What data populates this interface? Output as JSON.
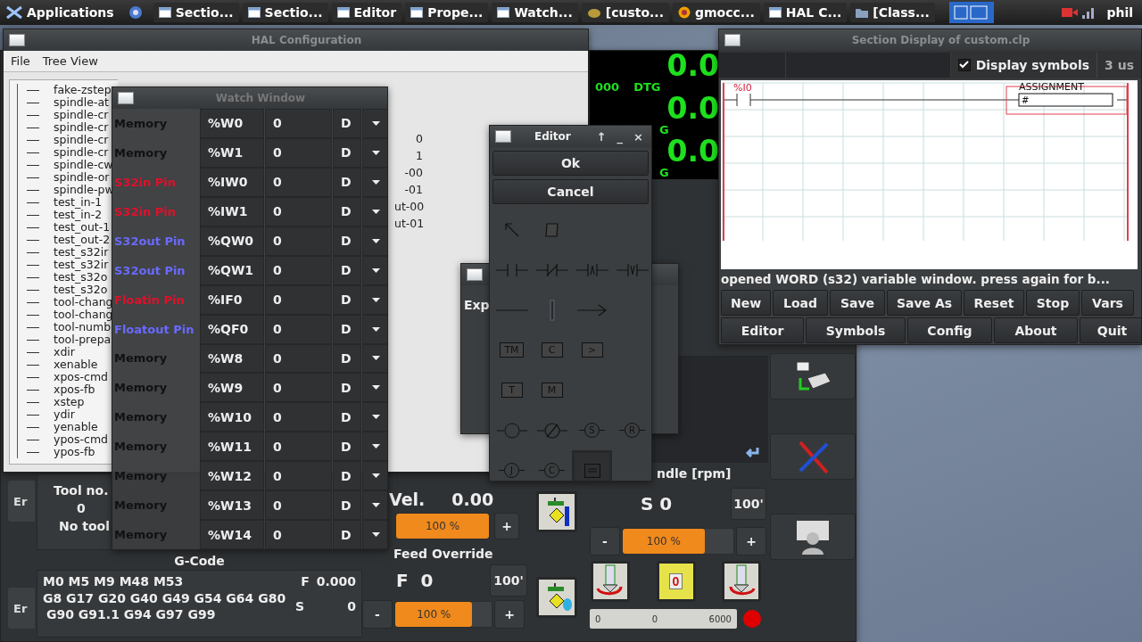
{
  "taskbar": {
    "menu": "Applications",
    "tasks": [
      {
        "label": "Sectio...",
        "kind": "window"
      },
      {
        "label": "Sectio...",
        "kind": "window"
      },
      {
        "label": "Editor",
        "kind": "window"
      },
      {
        "label": "Prope...",
        "kind": "window"
      },
      {
        "label": "Watch...",
        "kind": "window"
      },
      {
        "label": "[custo...",
        "kind": "app"
      },
      {
        "label": "gmocc...",
        "kind": "gmoccapy"
      },
      {
        "label": "HAL C...",
        "kind": "window"
      },
      {
        "label": "[Class...",
        "kind": "folder"
      }
    ],
    "user": "phil"
  },
  "hal_window": {
    "title": "HAL Configuration",
    "menu": [
      "File",
      "Tree View"
    ],
    "tree_items": [
      "fake-zstep",
      "spindle-at",
      "spindle-cr",
      "spindle-cr",
      "spindle-cr",
      "spindle-cr",
      "spindle-cw",
      "spindle-or",
      "spindle-pw",
      "test_in-1",
      "test_in-2",
      "test_out-1",
      "test_out-2",
      "test_s32ir",
      "test_s32ir",
      "test_s32o",
      "test_s32o",
      "tool-chang",
      "tool-chang",
      "tool-numb",
      "tool-prepa",
      "xdir",
      "xenable",
      "xpos-cmd",
      "xpos-fb",
      "xstep",
      "ydir",
      "yenable",
      "ypos-cmd",
      "ypos-fb"
    ],
    "fragments": [
      "0",
      "1",
      "-00",
      "-01",
      "ut-00",
      "ut-01"
    ]
  },
  "watch_window": {
    "title": "Watch Window",
    "rows": [
      {
        "kind": "memory",
        "label": "Memory",
        "variable": "%W0",
        "value": "0",
        "format": "D"
      },
      {
        "kind": "memory",
        "label": "Memory",
        "variable": "%W1",
        "value": "0",
        "format": "D"
      },
      {
        "kind": "s32in",
        "label": "S32in Pin",
        "variable": "%IW0",
        "value": "0",
        "format": "D"
      },
      {
        "kind": "s32in",
        "label": "S32in Pin",
        "variable": "%IW1",
        "value": "0",
        "format": "D"
      },
      {
        "kind": "s32out",
        "label": "S32out Pin",
        "variable": "%QW0",
        "value": "0",
        "format": "D"
      },
      {
        "kind": "s32out",
        "label": "S32out Pin",
        "variable": "%QW1",
        "value": "0",
        "format": "D"
      },
      {
        "kind": "floatin",
        "label": "Floatin Pin",
        "variable": "%IF0",
        "value": "0",
        "format": "D"
      },
      {
        "kind": "floatout",
        "label": "Floatout Pin",
        "variable": "%QF0",
        "value": "0",
        "format": "D"
      },
      {
        "kind": "memory",
        "label": "Memory",
        "variable": "%W8",
        "value": "0",
        "format": "D"
      },
      {
        "kind": "memory",
        "label": "Memory",
        "variable": "%W9",
        "value": "0",
        "format": "D"
      },
      {
        "kind": "memory",
        "label": "Memory",
        "variable": "%W10",
        "value": "0",
        "format": "D"
      },
      {
        "kind": "memory",
        "label": "Memory",
        "variable": "%W11",
        "value": "0",
        "format": "D"
      },
      {
        "kind": "memory",
        "label": "Memory",
        "variable": "%W12",
        "value": "0",
        "format": "D"
      },
      {
        "kind": "memory",
        "label": "Memory",
        "variable": "%W13",
        "value": "0",
        "format": "D"
      },
      {
        "kind": "memory",
        "label": "Memory",
        "variable": "%W14",
        "value": "0",
        "format": "D"
      }
    ]
  },
  "properties_window": {
    "label": "Exp"
  },
  "editor": {
    "title": "Editor",
    "controls": [
      "↑",
      "_",
      "×"
    ],
    "buttons": [
      "Ok",
      "Cancel"
    ],
    "tools": [
      [
        {
          "kind": "pointer",
          "selected": false
        },
        {
          "kind": "eraser",
          "selected": false
        }
      ],
      [
        {
          "kind": "contact",
          "selected": false
        },
        {
          "kind": "contact-negated",
          "selected": false
        },
        {
          "kind": "contact-rising",
          "selected": false
        },
        {
          "kind": "contact-falling",
          "selected": false
        }
      ],
      [
        {
          "kind": "hline",
          "selected": false
        },
        {
          "kind": "vline",
          "selected": false
        },
        {
          "kind": "connector",
          "selected": false
        }
      ],
      [
        {
          "kind": "block",
          "label": "TM",
          "selected": false
        },
        {
          "kind": "block",
          "label": "C",
          "selected": false
        },
        {
          "kind": "block",
          "label": ">",
          "selected": false
        }
      ],
      [
        {
          "kind": "block",
          "label": "T",
          "selected": false
        },
        {
          "kind": "block",
          "label": "M",
          "selected": false
        }
      ],
      [
        {
          "kind": "coil",
          "selected": false
        },
        {
          "kind": "coil-negated",
          "selected": false
        },
        {
          "kind": "coil",
          "label": "S",
          "selected": false
        },
        {
          "kind": "coil",
          "label": "R",
          "selected": false
        }
      ],
      [
        {
          "kind": "coil",
          "label": "J",
          "selected": false
        },
        {
          "kind": "coil",
          "label": "C",
          "selected": false
        },
        {
          "kind": "operate",
          "selected": true
        }
      ]
    ]
  },
  "dro": [
    {
      "value": "0.0",
      "captions": [
        "000",
        "DTG"
      ]
    },
    {
      "value": "0.0",
      "captions": [
        "G"
      ]
    },
    {
      "value": "0.0",
      "captions": [
        "G"
      ]
    }
  ],
  "section_display": {
    "title": "Section Display of custom.clp",
    "display_symbols": {
      "label": "Display symbols",
      "checked": true
    },
    "scan_time": "3 us",
    "rung": {
      "contact": "%I0",
      "block_title": "ASSIGNMENT",
      "block_text": "#"
    },
    "status": "opened WORD (s32) variable window. press again for b...",
    "buttons": [
      [
        "New",
        "Load",
        "Save",
        "Save As",
        "Reset",
        "Stop",
        "Vars"
      ],
      [
        "Editor",
        "Symbols",
        "Config",
        "About",
        "Quit"
      ]
    ]
  },
  "gmoccapy": {
    "side_tabs": [
      "Er",
      "Er"
    ],
    "tool": {
      "label": "Tool no.",
      "number": "0",
      "name": "No tool"
    },
    "gcode": {
      "title": "G-Code",
      "mcodes": "M0 M5 M9 M48 M53",
      "gcodes": [
        "G8 G17 G20 G40 G49 G54 G64 G80",
        "G90 G91.1 G94 G97 G99"
      ],
      "f_label": "F",
      "f_value": "0.000",
      "s_label": "S",
      "s_value": "0"
    },
    "velocity": {
      "label": "Vel.",
      "value": "0.00",
      "slider": {
        "text": "100 %",
        "level": 1
      },
      "plus": "+"
    },
    "feed_override": {
      "title": "Feed Override",
      "value": "F  0",
      "max": "100'",
      "minus": "-",
      "slider": {
        "text": "100 %",
        "level": 0.8
      },
      "plus": "+"
    },
    "spindle": {
      "title": "ndle [rpm]",
      "value": "S 0",
      "max": "100'",
      "minus": "-",
      "slider": {
        "text": "100 %",
        "level": 0.74
      },
      "plus": "+",
      "buttons": [
        {
          "kind": "ccw",
          "selected": false
        },
        {
          "kind": "stop",
          "label": "0",
          "selected": true
        },
        {
          "kind": "cw",
          "selected": false
        }
      ],
      "bar": [
        "0",
        "0",
        "6000"
      ]
    }
  }
}
